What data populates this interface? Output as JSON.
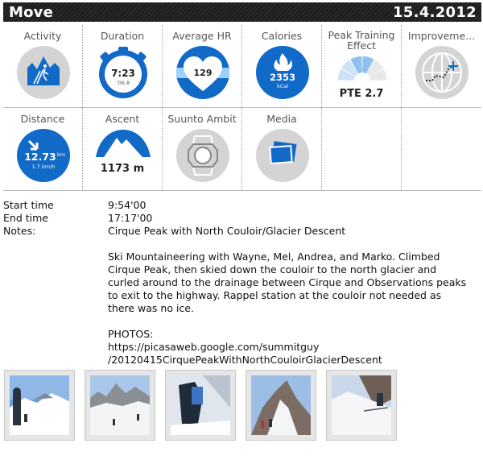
{
  "header": {
    "title": "Move",
    "date": "15.4.2012"
  },
  "tiles_row1": [
    {
      "label": "Activity",
      "icon": "ski-touring-icon"
    },
    {
      "label": "Duration",
      "value": "7:23",
      "sub": "'06.8",
      "icon": "stopwatch-icon"
    },
    {
      "label": "Average HR",
      "value": "129",
      "icon": "heart-icon"
    },
    {
      "label": "Calories",
      "value": "2353",
      "unit": "kCal",
      "icon": "flame-icon"
    },
    {
      "label": "Peak Training",
      "label2": "Effect",
      "value": "PTE 2.7",
      "level": 2.7,
      "icon": "gauge-icon"
    },
    {
      "label": "Improveme...",
      "icon": "globe-route-icon"
    }
  ],
  "tiles_row2": [
    {
      "label": "Distance",
      "value": "12.73",
      "unit": "km",
      "sub": "1.7 km/h",
      "icon": "arrow-icon"
    },
    {
      "label": "Ascent",
      "value": "1173 m",
      "icon": "mountain-icon"
    },
    {
      "label": "Suunto Ambit",
      "icon": "watch-icon"
    },
    {
      "label": "Media",
      "icon": "photos-icon"
    }
  ],
  "details": {
    "start_label": "Start time",
    "start_value": "9:54'00",
    "end_label": "End time",
    "end_value": "17:17'00",
    "notes_label": "Notes:",
    "notes_value": "Cirque Peak with North Couloir/Glacier Descent"
  },
  "notes": {
    "paragraph1": "Ski Mountaineering with Wayne, Mel, Andrea, and Marko. Climbed Cirque Peak, then skied down the couloir to the north glacier and curled around to the drainage between Cirque and Observations peaks to exit to the highway. Rappel station at the couloir not needed as there was no ice.",
    "photos_label": "PHOTOS:",
    "photos_url1": "https://picasaweb.google.com/summitguy",
    "photos_url2": "/20120415CirquePeakWithNorthCouloirGlacierDescent"
  },
  "colors": {
    "blue": "#1169c8",
    "grey": "#d4d4d4",
    "header_bg": "#222222"
  }
}
